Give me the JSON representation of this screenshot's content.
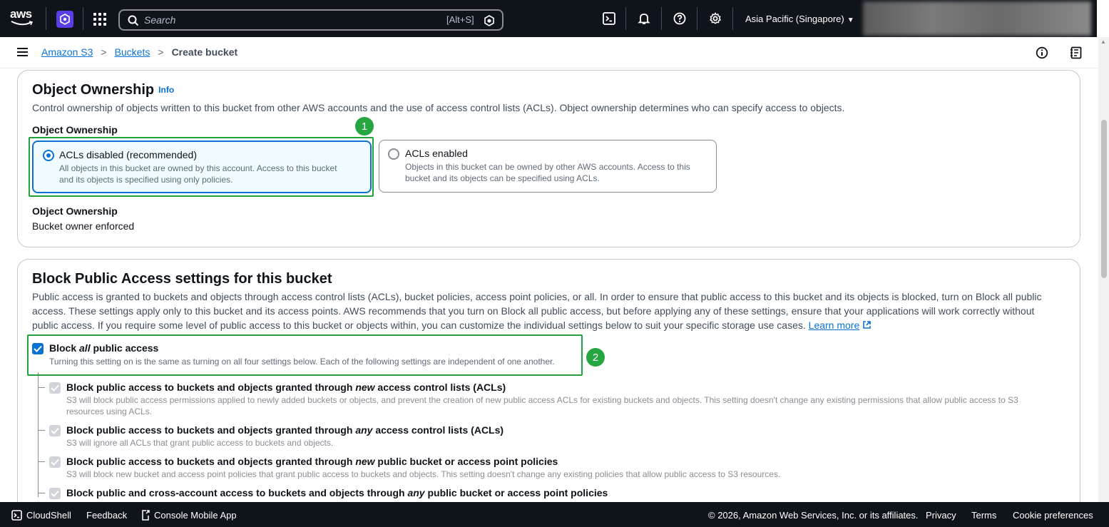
{
  "topnav": {
    "logo_text": "aws",
    "search_placeholder": "Search",
    "search_shortcut": "[Alt+S]",
    "region": "Asia Pacific (Singapore)",
    "icons": [
      "cloudshell-icon",
      "bell-icon",
      "help-icon",
      "gear-icon"
    ]
  },
  "breadcrumb": {
    "items": [
      "Amazon S3",
      "Buckets"
    ],
    "current": "Create bucket",
    "separator": ">"
  },
  "object_ownership": {
    "title": "Object Ownership",
    "info": "Info",
    "description": "Control ownership of objects written to this bucket from other AWS accounts and the use of access control lists (ACLs). Object ownership determines who can specify access to objects.",
    "field_label": "Object Ownership",
    "options": [
      {
        "title": "ACLs disabled (recommended)",
        "desc_line1": "All objects in this bucket are owned by this account. Access to this bucket",
        "desc_line2": "and its objects is specified using only policies.",
        "selected": true
      },
      {
        "title": "ACLs enabled",
        "desc_line1": "Objects in this bucket can be owned by other AWS accounts. Access to this",
        "desc_line2": "bucket and its objects can be specified using ACLs.",
        "selected": false
      }
    ],
    "summary_label": "Object Ownership",
    "summary_value": "Bucket owner enforced"
  },
  "block_public_access": {
    "title": "Block Public Access settings for this bucket",
    "description_line1": "Public access is granted to buckets and objects through access control lists (ACLs), bucket policies, access point policies, or all. In order to ensure that public access to this bucket and its objects is blocked, turn on Block all public",
    "description_line2": "access. These settings apply only to this bucket and its access points. AWS recommends that you turn on Block all public access, but before applying any of these settings, ensure that your applications will work correctly without",
    "description_line3": "public access. If you require some level of public access to this bucket or objects within, you can customize the individual settings below to suit your specific storage use cases.",
    "learn_more": "Learn more",
    "block_all": {
      "title_pre": "Block ",
      "title_em": "all",
      "title_post": " public access",
      "desc": "Turning this setting on is the same as turning on all four settings below. Each of the following settings are independent of one another.",
      "checked": true
    },
    "sub_settings": [
      {
        "title_pre": "Block public access to buckets and objects granted through ",
        "title_em": "new",
        "title_post": " access control lists (ACLs)",
        "desc_line1": "S3 will block public access permissions applied to newly added buckets or objects, and prevent the creation of new public access ACLs for existing buckets and objects. This setting doesn't change any existing permissions that allow public access to S3",
        "desc_line2": "resources using ACLs."
      },
      {
        "title_pre": "Block public access to buckets and objects granted through ",
        "title_em": "any",
        "title_post": " access control lists (ACLs)",
        "desc_line1": "S3 will ignore all ACLs that grant public access to buckets and objects.",
        "desc_line2": ""
      },
      {
        "title_pre": "Block public access to buckets and objects granted through ",
        "title_em": "new",
        "title_post": " public bucket or access point policies",
        "desc_line1": "S3 will block new bucket and access point policies that grant public access to buckets and objects. This setting doesn't change any existing policies that allow public access to S3 resources.",
        "desc_line2": ""
      },
      {
        "title_pre": "Block public and cross-account access to buckets and objects through ",
        "title_em": "any",
        "title_post": " public bucket or access point policies",
        "desc_line1": "",
        "desc_line2": ""
      }
    ]
  },
  "annotations": {
    "badge1": "1",
    "badge2": "2",
    "color": "#20a33a"
  },
  "footer": {
    "cloudshell": "CloudShell",
    "feedback": "Feedback",
    "console_mobile": "Console Mobile App",
    "copyright": "© 2026, Amazon Web Services, Inc. or its affiliates.",
    "privacy": "Privacy",
    "terms": "Terms",
    "cookie": "Cookie preferences"
  },
  "colors": {
    "nav_bg": "#0f141a",
    "link": "#0972d3",
    "selected_tile_bg": "#f0fbff",
    "annotation_green": "#20a33a"
  }
}
